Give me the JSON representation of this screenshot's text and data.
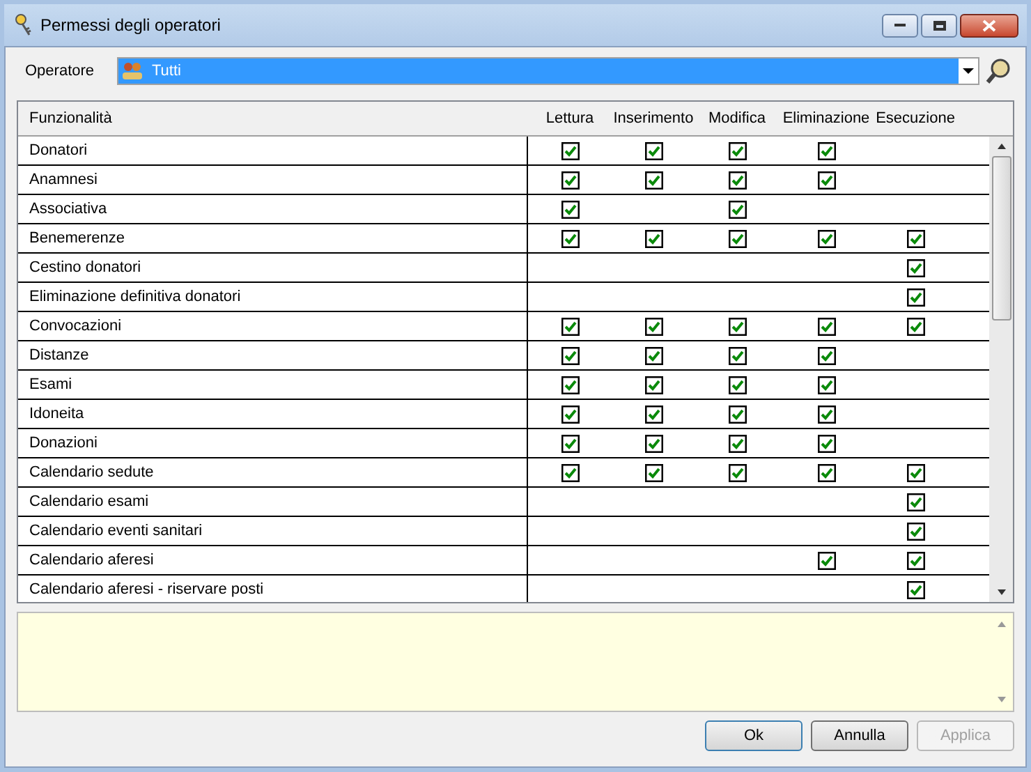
{
  "window": {
    "title": "Permessi degli operatori"
  },
  "operator": {
    "label": "Operatore",
    "value": "Tutti"
  },
  "table": {
    "columns": [
      "Funzionalità",
      "Lettura",
      "Inserimento",
      "Modifica",
      "Eliminazione",
      "Esecuzione"
    ],
    "rows": [
      {
        "name": "Donatori",
        "cells": [
          true,
          true,
          true,
          true,
          false
        ]
      },
      {
        "name": "Anamnesi",
        "cells": [
          true,
          true,
          true,
          true,
          false
        ]
      },
      {
        "name": "Associativa",
        "cells": [
          true,
          false,
          true,
          false,
          false
        ]
      },
      {
        "name": "Benemerenze",
        "cells": [
          true,
          true,
          true,
          true,
          true
        ]
      },
      {
        "name": "Cestino donatori",
        "cells": [
          false,
          false,
          false,
          false,
          true
        ]
      },
      {
        "name": "Eliminazione definitiva donatori",
        "cells": [
          false,
          false,
          false,
          false,
          true
        ]
      },
      {
        "name": "Convocazioni",
        "cells": [
          true,
          true,
          true,
          true,
          true
        ]
      },
      {
        "name": "Distanze",
        "cells": [
          true,
          true,
          true,
          true,
          false
        ]
      },
      {
        "name": "Esami",
        "cells": [
          true,
          true,
          true,
          true,
          false
        ]
      },
      {
        "name": "Idoneita",
        "cells": [
          true,
          true,
          true,
          true,
          false
        ]
      },
      {
        "name": "Donazioni",
        "cells": [
          true,
          true,
          true,
          true,
          false
        ]
      },
      {
        "name": "Calendario sedute",
        "cells": [
          true,
          true,
          true,
          true,
          true
        ]
      },
      {
        "name": "Calendario esami",
        "cells": [
          false,
          false,
          false,
          false,
          true
        ]
      },
      {
        "name": "Calendario eventi sanitari",
        "cells": [
          false,
          false,
          false,
          false,
          true
        ]
      },
      {
        "name": "Calendario aferesi",
        "cells": [
          false,
          false,
          false,
          true,
          true
        ]
      },
      {
        "name": "Calendario aferesi - riservare posti",
        "cells": [
          false,
          false,
          false,
          false,
          true
        ]
      }
    ]
  },
  "buttons": [
    {
      "label": "Ok",
      "disabled": false,
      "default": true
    },
    {
      "label": "Annulla",
      "disabled": false,
      "default": false
    },
    {
      "label": "Applica",
      "disabled": true,
      "default": false
    }
  ]
}
